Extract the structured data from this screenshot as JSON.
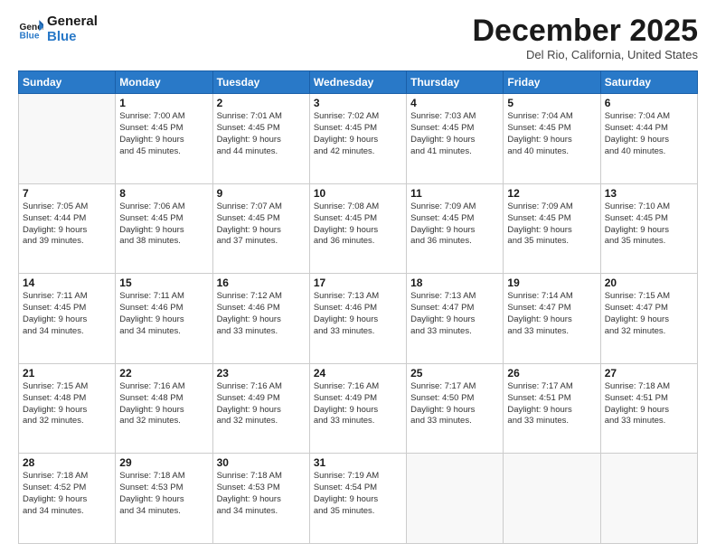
{
  "header": {
    "logo_line1": "General",
    "logo_line2": "Blue",
    "month": "December 2025",
    "location": "Del Rio, California, United States"
  },
  "weekdays": [
    "Sunday",
    "Monday",
    "Tuesday",
    "Wednesday",
    "Thursday",
    "Friday",
    "Saturday"
  ],
  "weeks": [
    [
      {
        "day": "",
        "lines": []
      },
      {
        "day": "1",
        "lines": [
          "Sunrise: 7:00 AM",
          "Sunset: 4:45 PM",
          "Daylight: 9 hours",
          "and 45 minutes."
        ]
      },
      {
        "day": "2",
        "lines": [
          "Sunrise: 7:01 AM",
          "Sunset: 4:45 PM",
          "Daylight: 9 hours",
          "and 44 minutes."
        ]
      },
      {
        "day": "3",
        "lines": [
          "Sunrise: 7:02 AM",
          "Sunset: 4:45 PM",
          "Daylight: 9 hours",
          "and 42 minutes."
        ]
      },
      {
        "day": "4",
        "lines": [
          "Sunrise: 7:03 AM",
          "Sunset: 4:45 PM",
          "Daylight: 9 hours",
          "and 41 minutes."
        ]
      },
      {
        "day": "5",
        "lines": [
          "Sunrise: 7:04 AM",
          "Sunset: 4:45 PM",
          "Daylight: 9 hours",
          "and 40 minutes."
        ]
      },
      {
        "day": "6",
        "lines": [
          "Sunrise: 7:04 AM",
          "Sunset: 4:44 PM",
          "Daylight: 9 hours",
          "and 40 minutes."
        ]
      }
    ],
    [
      {
        "day": "7",
        "lines": [
          "Sunrise: 7:05 AM",
          "Sunset: 4:44 PM",
          "Daylight: 9 hours",
          "and 39 minutes."
        ]
      },
      {
        "day": "8",
        "lines": [
          "Sunrise: 7:06 AM",
          "Sunset: 4:45 PM",
          "Daylight: 9 hours",
          "and 38 minutes."
        ]
      },
      {
        "day": "9",
        "lines": [
          "Sunrise: 7:07 AM",
          "Sunset: 4:45 PM",
          "Daylight: 9 hours",
          "and 37 minutes."
        ]
      },
      {
        "day": "10",
        "lines": [
          "Sunrise: 7:08 AM",
          "Sunset: 4:45 PM",
          "Daylight: 9 hours",
          "and 36 minutes."
        ]
      },
      {
        "day": "11",
        "lines": [
          "Sunrise: 7:09 AM",
          "Sunset: 4:45 PM",
          "Daylight: 9 hours",
          "and 36 minutes."
        ]
      },
      {
        "day": "12",
        "lines": [
          "Sunrise: 7:09 AM",
          "Sunset: 4:45 PM",
          "Daylight: 9 hours",
          "and 35 minutes."
        ]
      },
      {
        "day": "13",
        "lines": [
          "Sunrise: 7:10 AM",
          "Sunset: 4:45 PM",
          "Daylight: 9 hours",
          "and 35 minutes."
        ]
      }
    ],
    [
      {
        "day": "14",
        "lines": [
          "Sunrise: 7:11 AM",
          "Sunset: 4:45 PM",
          "Daylight: 9 hours",
          "and 34 minutes."
        ]
      },
      {
        "day": "15",
        "lines": [
          "Sunrise: 7:11 AM",
          "Sunset: 4:46 PM",
          "Daylight: 9 hours",
          "and 34 minutes."
        ]
      },
      {
        "day": "16",
        "lines": [
          "Sunrise: 7:12 AM",
          "Sunset: 4:46 PM",
          "Daylight: 9 hours",
          "and 33 minutes."
        ]
      },
      {
        "day": "17",
        "lines": [
          "Sunrise: 7:13 AM",
          "Sunset: 4:46 PM",
          "Daylight: 9 hours",
          "and 33 minutes."
        ]
      },
      {
        "day": "18",
        "lines": [
          "Sunrise: 7:13 AM",
          "Sunset: 4:47 PM",
          "Daylight: 9 hours",
          "and 33 minutes."
        ]
      },
      {
        "day": "19",
        "lines": [
          "Sunrise: 7:14 AM",
          "Sunset: 4:47 PM",
          "Daylight: 9 hours",
          "and 33 minutes."
        ]
      },
      {
        "day": "20",
        "lines": [
          "Sunrise: 7:15 AM",
          "Sunset: 4:47 PM",
          "Daylight: 9 hours",
          "and 32 minutes."
        ]
      }
    ],
    [
      {
        "day": "21",
        "lines": [
          "Sunrise: 7:15 AM",
          "Sunset: 4:48 PM",
          "Daylight: 9 hours",
          "and 32 minutes."
        ]
      },
      {
        "day": "22",
        "lines": [
          "Sunrise: 7:16 AM",
          "Sunset: 4:48 PM",
          "Daylight: 9 hours",
          "and 32 minutes."
        ]
      },
      {
        "day": "23",
        "lines": [
          "Sunrise: 7:16 AM",
          "Sunset: 4:49 PM",
          "Daylight: 9 hours",
          "and 32 minutes."
        ]
      },
      {
        "day": "24",
        "lines": [
          "Sunrise: 7:16 AM",
          "Sunset: 4:49 PM",
          "Daylight: 9 hours",
          "and 33 minutes."
        ]
      },
      {
        "day": "25",
        "lines": [
          "Sunrise: 7:17 AM",
          "Sunset: 4:50 PM",
          "Daylight: 9 hours",
          "and 33 minutes."
        ]
      },
      {
        "day": "26",
        "lines": [
          "Sunrise: 7:17 AM",
          "Sunset: 4:51 PM",
          "Daylight: 9 hours",
          "and 33 minutes."
        ]
      },
      {
        "day": "27",
        "lines": [
          "Sunrise: 7:18 AM",
          "Sunset: 4:51 PM",
          "Daylight: 9 hours",
          "and 33 minutes."
        ]
      }
    ],
    [
      {
        "day": "28",
        "lines": [
          "Sunrise: 7:18 AM",
          "Sunset: 4:52 PM",
          "Daylight: 9 hours",
          "and 34 minutes."
        ]
      },
      {
        "day": "29",
        "lines": [
          "Sunrise: 7:18 AM",
          "Sunset: 4:53 PM",
          "Daylight: 9 hours",
          "and 34 minutes."
        ]
      },
      {
        "day": "30",
        "lines": [
          "Sunrise: 7:18 AM",
          "Sunset: 4:53 PM",
          "Daylight: 9 hours",
          "and 34 minutes."
        ]
      },
      {
        "day": "31",
        "lines": [
          "Sunrise: 7:19 AM",
          "Sunset: 4:54 PM",
          "Daylight: 9 hours",
          "and 35 minutes."
        ]
      },
      {
        "day": "",
        "lines": []
      },
      {
        "day": "",
        "lines": []
      },
      {
        "day": "",
        "lines": []
      }
    ]
  ]
}
